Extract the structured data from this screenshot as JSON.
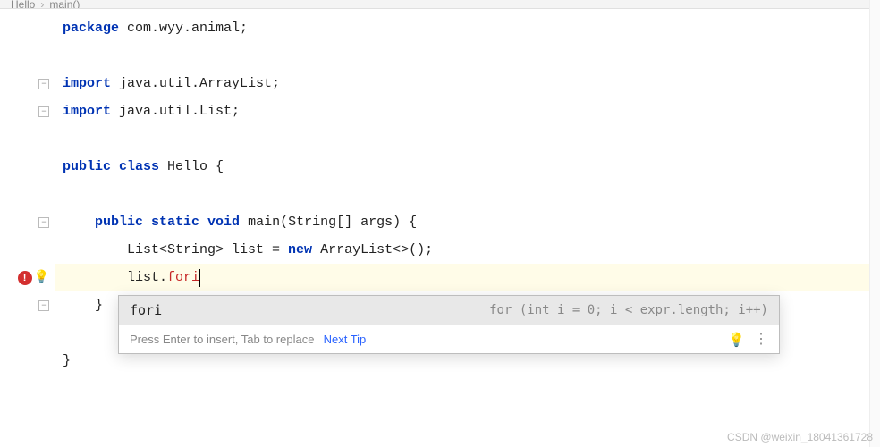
{
  "breadcrumb": {
    "item1": "Hello",
    "sep": "›",
    "item2": "main()"
  },
  "code": {
    "package_kw": "package",
    "package_name": " com.wyy.animal;",
    "import_kw": "import",
    "import1": " java.util.ArrayList;",
    "import2": " java.util.List;",
    "public_kw": "public",
    "class_kw": " class",
    "class_name": " Hello {",
    "static_kw": " static",
    "void_kw": " void",
    "main_sig": " main(String[] args) {",
    "list_decl_pre": "List<String> list = ",
    "new_kw": "new",
    "list_decl_post": " ArrayList<>();",
    "list_var": "list.",
    "typed": "fori",
    "close_brace": "}",
    "indent1": "    ",
    "indent2": "        "
  },
  "completion": {
    "name": "fori",
    "preview": "for (int i = 0; i < expr.length; i++)",
    "hint": "Press Enter to insert, Tab to replace",
    "link": "Next Tip"
  },
  "watermark": "CSDN @weixin_18041361728"
}
